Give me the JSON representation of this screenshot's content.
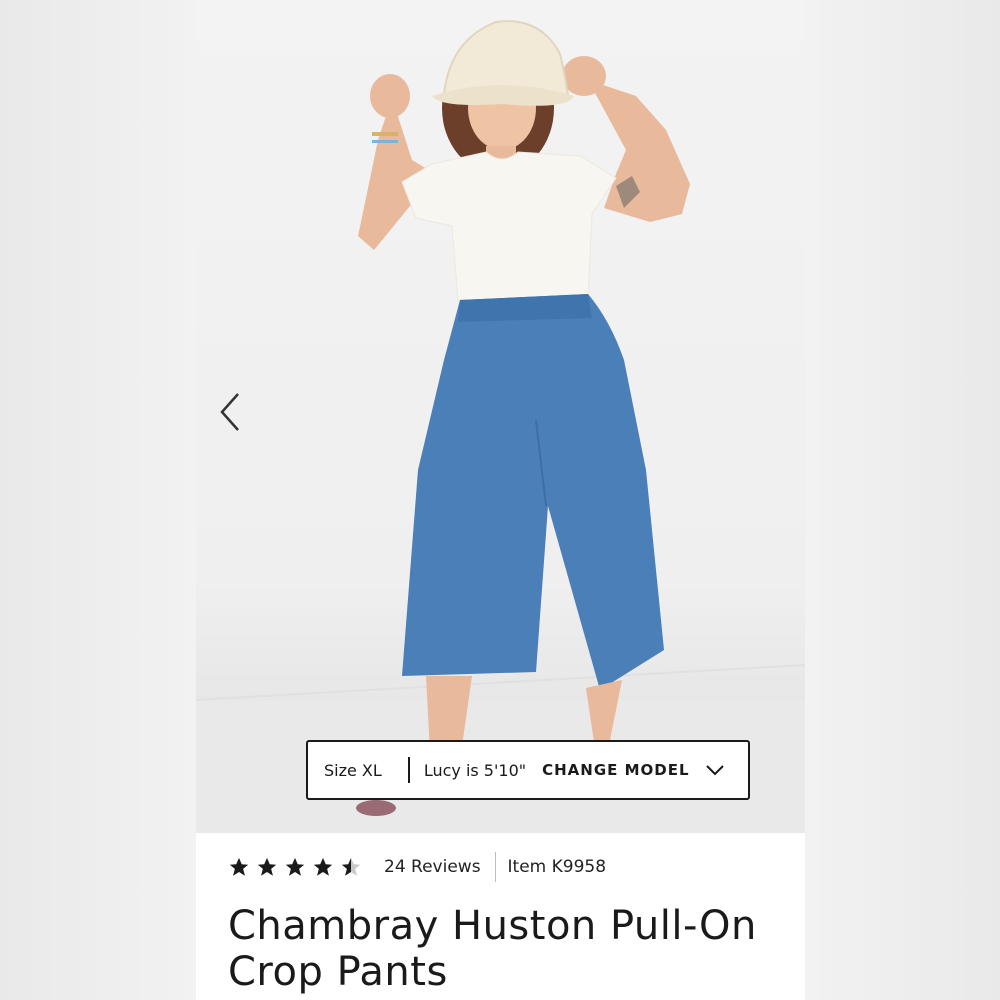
{
  "product": {
    "title": "Chambray Huston Pull-On Crop Pants",
    "image_alt": "Model wearing chambray wide-leg crop pants, white tee and cream bucket hat"
  },
  "model_bar": {
    "size": "Size XL",
    "model_height": "Lucy is 5'10\"",
    "change_label": "CHANGE MODEL"
  },
  "rating": {
    "stars": 4.5,
    "reviews_label": "24 Reviews",
    "item_label": "Item K9958"
  },
  "icons": {
    "prev": "chevron-left-icon",
    "dropdown": "chevron-down-icon",
    "star": "star-icon"
  },
  "colors": {
    "text": "#1a1a1a",
    "denim": "#4a7fb8",
    "background": "#ffffff"
  }
}
